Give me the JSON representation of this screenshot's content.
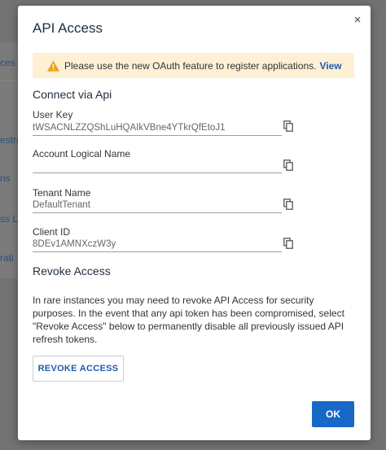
{
  "background": {
    "fragments": [
      "ces",
      "estra",
      "ns",
      "ss L",
      "rati"
    ]
  },
  "modal": {
    "title": "API Access",
    "close_glyph": "×",
    "alert": {
      "text": "Please use the new OAuth feature to register applications.",
      "link": "View"
    },
    "connect_heading": "Connect via Api",
    "fields": [
      {
        "label": "User Key",
        "value": "tWSACNLZZQShLuHQAIkVBne4YTkrQfEtoJ1"
      },
      {
        "label": "Account Logical Name",
        "value": ""
      },
      {
        "label": "Tenant Name",
        "value": "DefaultTenant"
      },
      {
        "label": "Client ID",
        "value": "8DEv1AMNXczW3y"
      }
    ],
    "revoke_heading": "Revoke Access",
    "revoke_text": "In rare instances you may need to revoke API Access for security purposes. In the event that any api token has been compromised, select \"Revoke Access\" below to permanently disable all previously issued API refresh tokens.",
    "revoke_button": "REVOKE ACCESS",
    "ok_button": "OK"
  },
  "icons": {
    "alert": "warning-icon",
    "copy": "copy-icon",
    "close": "close-icon"
  },
  "colors": {
    "accent": "#1768c7",
    "link": "#1f5ca8",
    "alert_bg": "#fdf0d5",
    "warning": "#e8a317"
  }
}
